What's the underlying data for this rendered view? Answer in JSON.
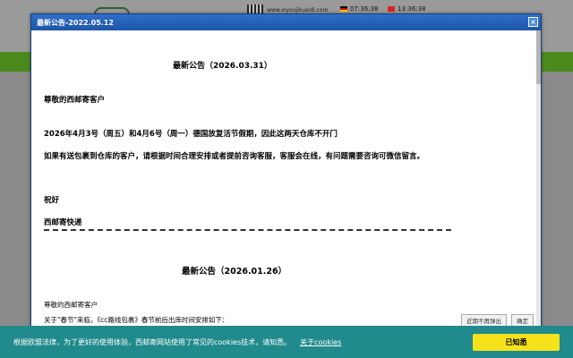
{
  "background": {
    "site_text": "www.xiyoujikuaidi.com",
    "clock_de": "07:36:38",
    "clock_cn": "13:36:38"
  },
  "dialog": {
    "title": "最新公告-2022.05.12",
    "close_symbol": "×",
    "notice1": {
      "heading": "最新公告（2026.03.31）",
      "greeting": "尊敬的西邮寄客户",
      "line1": "2026年4月3号（周五）和4月6号（周一）德国放复活节假期，因此这两天仓库不开门",
      "line2": "如果有送包裹到仓库的客户，请根据时间合理安排或者提前咨询客服，客服会在线，有问题需要咨询可微信留言。",
      "closing": "祝好",
      "signature": "西邮寄快递"
    },
    "divider": "------------------------------------------------------------------------------------------------------------------------",
    "notice2": {
      "heading": "最新公告（2026.01.26）",
      "greeting": "尊敬的西邮寄客户",
      "line1": "关于\"春节\"来临，《cc路线包裹》春节前后出库时间安排如下："
    },
    "btn_dont_show": "近期不再弹出",
    "btn_ok": "确定"
  },
  "cookie_bar": {
    "text": "根据欧盟法律，为了更好的使用体验，西邮寄网站使用了常见的cookies技术，请知悉。",
    "link": "关于cookies",
    "accept": "已知悉"
  }
}
